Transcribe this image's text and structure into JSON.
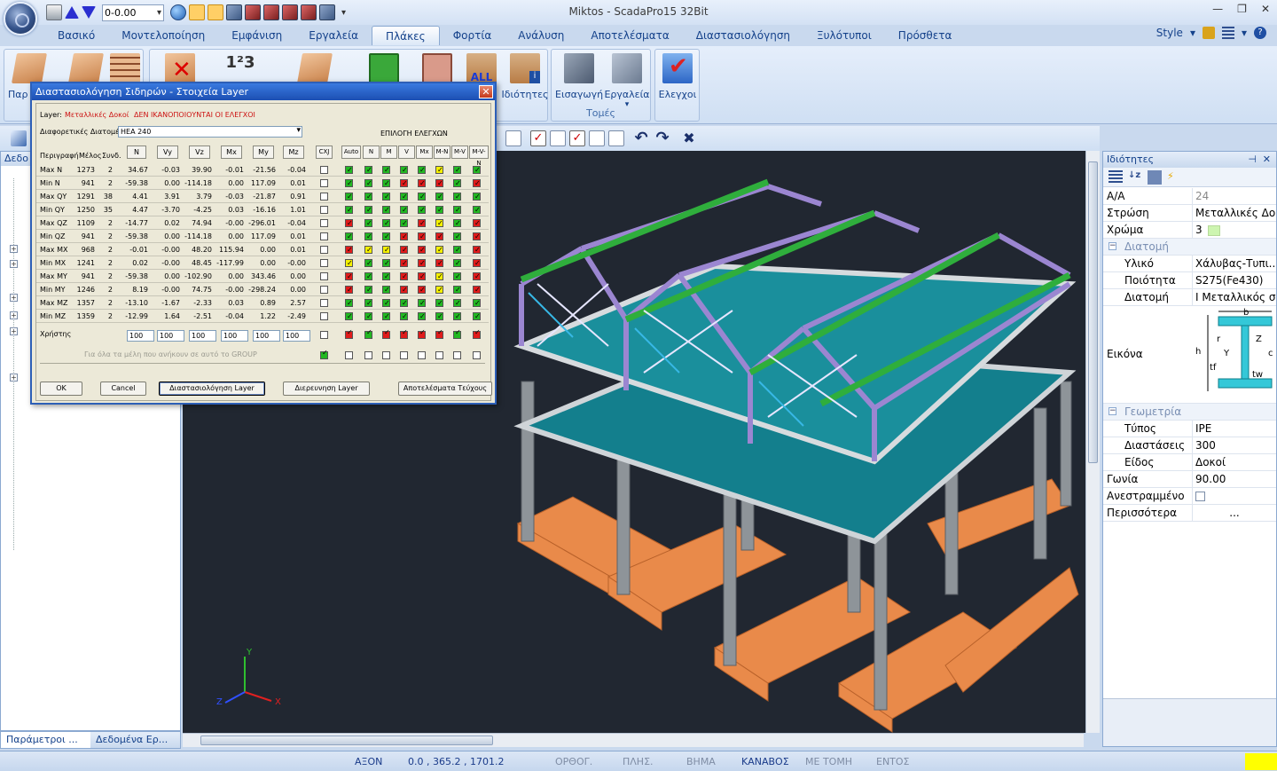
{
  "window": {
    "title": "Miktos - ScadaPro15 32Bit"
  },
  "quick_access": {
    "level_value": "0-0.00"
  },
  "ribbon_tabs": [
    "Βασικό",
    "Μοντελοποίηση",
    "Εμφάνιση",
    "Εργαλεία",
    "Πλάκες",
    "Φορτία",
    "Ανάλυση",
    "Αποτελέσματα",
    "Διαστασιολόγηση",
    "Ξυλότυποι",
    "Πρόσθετα"
  ],
  "active_tab": "Πλάκες",
  "style_menu_label": "Style",
  "ribbon": {
    "params_label": "Παρ",
    "idiotites_label": "Ιδιότητες",
    "eisagogi_label": "Εισαγωγή",
    "ergaleia_label": "Εργαλεία",
    "tomes_group": "Τομές",
    "elegxoi_label": "Ελεγχοι"
  },
  "left_panel": {
    "header": "Δεδο",
    "tab_params": "Παράμετροι ...",
    "tab_data": "Δεδομένα Ερ..."
  },
  "properties": {
    "header": "Ιδιότητες",
    "rows": {
      "aa": {
        "k": "Α/Α",
        "v": "24"
      },
      "strosi": {
        "k": "Στρώση",
        "v": "Μεταλλικές Δο..."
      },
      "xroma": {
        "k": "Χρώμα",
        "v": "3"
      },
      "cat_diatomi": "Διατομή",
      "yliko": {
        "k": "Υλικό",
        "v": "Χάλυβας-Τυπι..."
      },
      "poiotita": {
        "k": "Ποιότητα",
        "v": "S275(Fe430)"
      },
      "diatomi": {
        "k": "Διατομή",
        "v": "I Μεταλλικός σ..."
      },
      "eikona": {
        "k": "Εικόνα"
      },
      "cat_geometria": "Γεωμετρία",
      "typos": {
        "k": "Τύπος",
        "v": "IPE"
      },
      "diastaseis": {
        "k": "Διαστάσεις",
        "v": "300"
      },
      "eidos": {
        "k": "Είδος",
        "v": "Δοκοί"
      },
      "gonia": {
        "k": "Γωνία",
        "v": "90.00"
      },
      "anestrammeno": {
        "k": "Ανεστραμμένο"
      },
      "perissotera": {
        "k": "Περισσότερα",
        "v": "..."
      }
    },
    "section_labels": {
      "b": "b",
      "h": "h",
      "tf": "tf",
      "tw": "tw",
      "r": "r",
      "Y": "Y",
      "Z": "Z",
      "c": "c"
    }
  },
  "dialog": {
    "title": "Διαστασιολόγηση Σιδηρών - Στοιχεία Layer",
    "layer_label": "Layer:",
    "layer_name": "Μεταλλικές Δοκοί",
    "status_msg": "ΔΕΝ ΙΚΑΝΟΠΟΙΟΥΝΤΑΙ ΟΙ ΕΛΕΓΧΟΙ",
    "sections_label": "Διαφορετικές Διατομές",
    "section_value": "HEA 240",
    "checks_title": "ΕΠΙΛΟΓΗ ΕΛΕΓΧΩΝ",
    "col_headers": {
      "desc": "Περιγραφή",
      "member": "Μέλος",
      "combo": "Συνδ."
    },
    "force_buttons": [
      "N",
      "Vy",
      "Vz",
      "Mx",
      "My",
      "Mz"
    ],
    "cxj_label": "CXJ",
    "check_buttons": [
      "Auto",
      "N",
      "M",
      "V",
      "Mx",
      "M-N",
      "M-V",
      "M-V-N"
    ],
    "rows": [
      {
        "desc": "Max N",
        "member": "1273",
        "combo": "2",
        "N": "34.67",
        "Vy": "-0.03",
        "Vz": "39.90",
        "Mx": "-0.01",
        "My": "-21.56",
        "Mz": "-0.04",
        "checks": "gggggygg"
      },
      {
        "desc": "Min N",
        "member": "941",
        "combo": "2",
        "N": "-59.38",
        "Vy": "0.00",
        "Vz": "-114.18",
        "Mx": "0.00",
        "My": "117.09",
        "Mz": "0.01",
        "checks": "gggrrrgr"
      },
      {
        "desc": "Max QY",
        "member": "1291",
        "combo": "38",
        "N": "4.41",
        "Vy": "3.91",
        "Vz": "3.79",
        "Mx": "-0.03",
        "My": "-21.87",
        "Mz": "0.91",
        "checks": "gggggggg"
      },
      {
        "desc": "Min QY",
        "member": "1250",
        "combo": "35",
        "N": "4.47",
        "Vy": "-3.70",
        "Vz": "-4.25",
        "Mx": "0.03",
        "My": "-16.16",
        "Mz": "1.01",
        "checks": "gggggggg"
      },
      {
        "desc": "Max QZ",
        "member": "1109",
        "combo": "2",
        "N": "-14.77",
        "Vy": "0.02",
        "Vz": "74.94",
        "Mx": "-0.00",
        "My": "-296.01",
        "Mz": "-0.04",
        "checks": "rgggrygr"
      },
      {
        "desc": "Min QZ",
        "member": "941",
        "combo": "2",
        "N": "-59.38",
        "Vy": "0.00",
        "Vz": "-114.18",
        "Mx": "0.00",
        "My": "117.09",
        "Mz": "0.01",
        "checks": "gggrrrgr"
      },
      {
        "desc": "Max MX",
        "member": "968",
        "combo": "2",
        "N": "-0.01",
        "Vy": "-0.00",
        "Vz": "48.20",
        "Mx": "115.94",
        "My": "0.00",
        "Mz": "0.01",
        "checks": "ryyrrygr"
      },
      {
        "desc": "Min MX",
        "member": "1241",
        "combo": "2",
        "N": "0.02",
        "Vy": "-0.00",
        "Vz": "48.45",
        "Mx": "-117.99",
        "My": "0.00",
        "Mz": "-0.00",
        "checks": "yggrrrgr"
      },
      {
        "desc": "Max MY",
        "member": "941",
        "combo": "2",
        "N": "-59.38",
        "Vy": "0.00",
        "Vz": "-102.90",
        "Mx": "0.00",
        "My": "343.46",
        "Mz": "0.00",
        "checks": "rggrrygr"
      },
      {
        "desc": "Min MY",
        "member": "1246",
        "combo": "2",
        "N": "8.19",
        "Vy": "-0.00",
        "Vz": "74.75",
        "Mx": "-0.00",
        "My": "-298.24",
        "Mz": "0.00",
        "checks": "rggrrygr"
      },
      {
        "desc": "Max MZ",
        "member": "1357",
        "combo": "2",
        "N": "-13.10",
        "Vy": "-1.67",
        "Vz": "-2.33",
        "Mx": "0.03",
        "My": "0.89",
        "Mz": "2.57",
        "checks": "gggggggg"
      },
      {
        "desc": "Min MZ",
        "member": "1359",
        "combo": "2",
        "N": "-12.99",
        "Vy": "1.64",
        "Vz": "-2.51",
        "Mx": "-0.04",
        "My": "1.22",
        "Mz": "-2.49",
        "checks": "gggggggg"
      }
    ],
    "user_row_label": "Χρήστης",
    "user_values": [
      "100",
      "100",
      "100",
      "100",
      "100",
      "100"
    ],
    "group_note": "Για όλα τα μέλη που ανήκουν σε αυτό το GROUP",
    "buttons": {
      "ok": "OK",
      "cancel": "Cancel",
      "design": "Διαστασιολόγηση Layer",
      "explore": "Διερευνηση Layer",
      "results": "Αποτελέσματα Τεύχους"
    }
  },
  "axes": {
    "x": "X",
    "y": "Y",
    "z": "Z"
  },
  "status": {
    "axon": "ΑΞΟΝ",
    "coords": "0.0 , 365.2 , 1701.2",
    "orthog": "ΟΡΘΟΓ.",
    "plis": "ΠΛΗΣ.",
    "vima": "ΒΗΜΑ",
    "kanavos": "ΚΑΝΑΒΟΣ",
    "me_tomi": "ΜΕ ΤΟΜΗ",
    "entos": "ΕΝΤΟΣ"
  }
}
